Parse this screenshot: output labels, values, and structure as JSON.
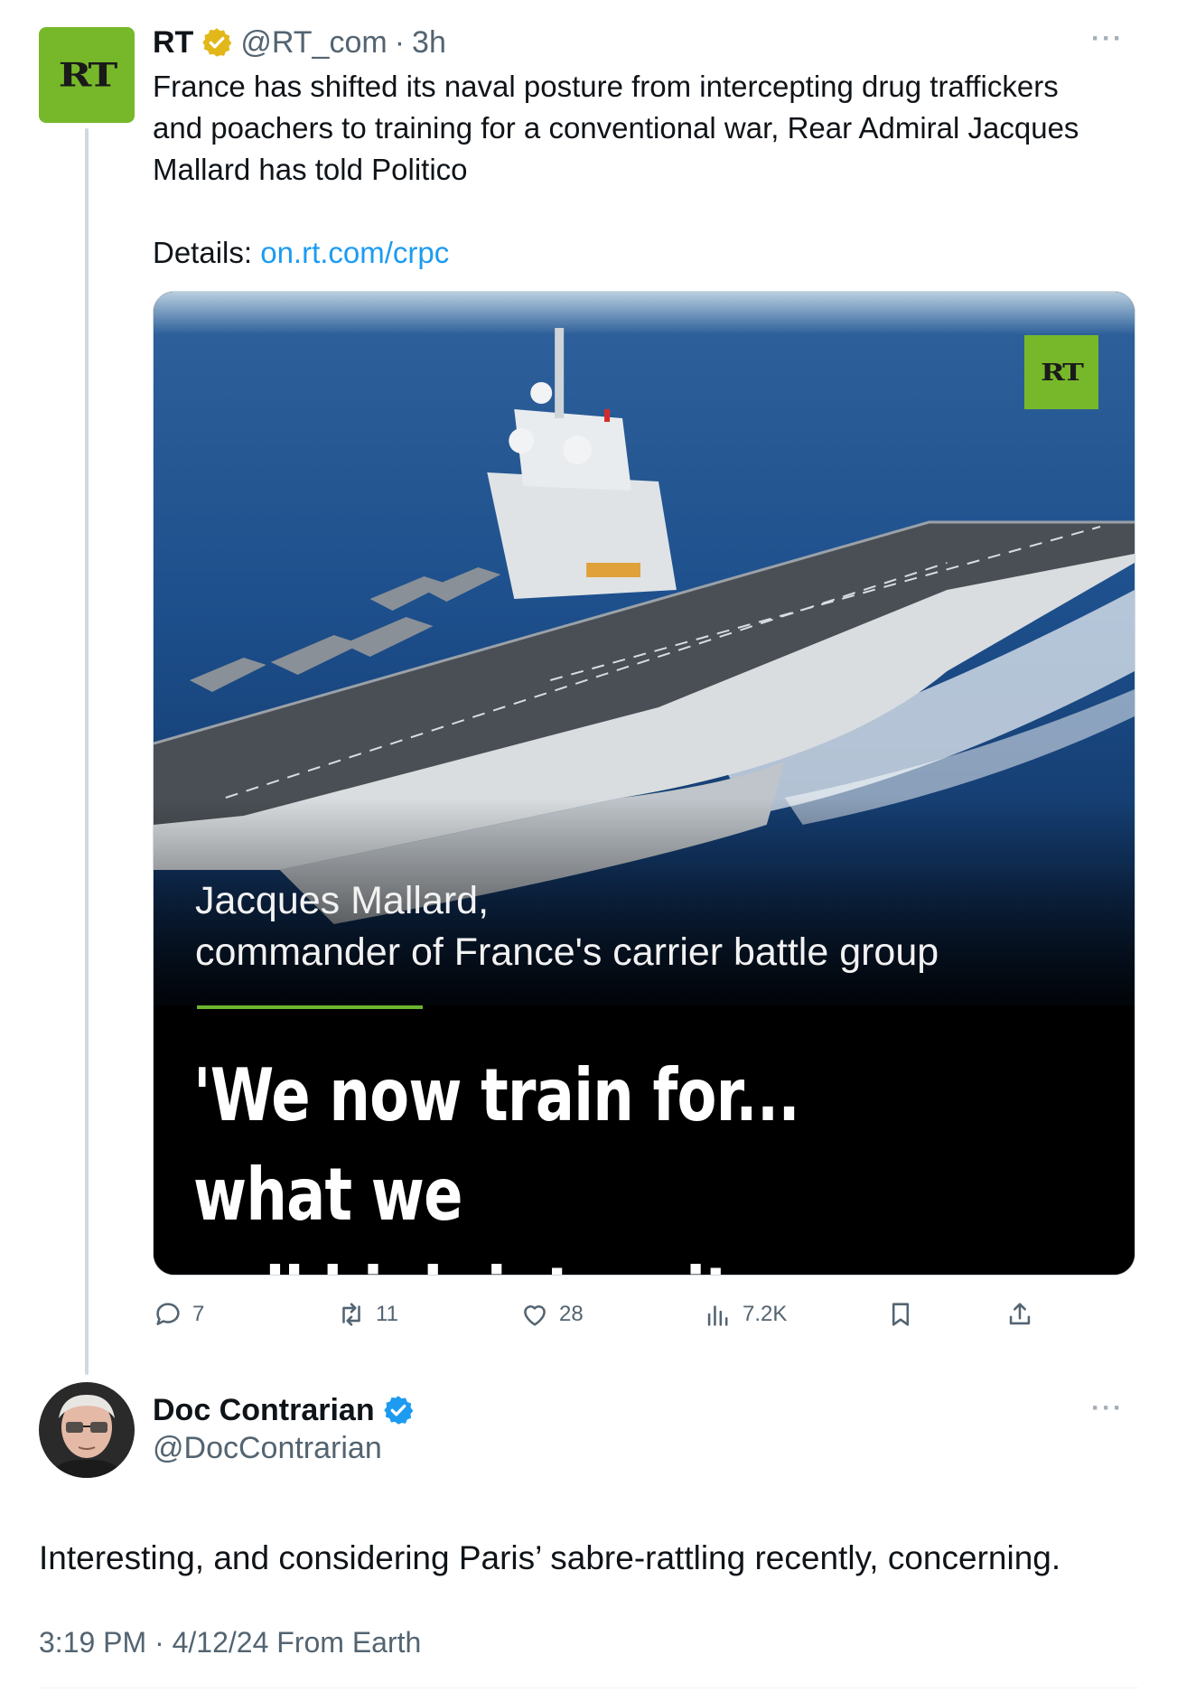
{
  "tweet": {
    "author_name": "RT",
    "handle": "@RT_com",
    "separator": "·",
    "time": "3h",
    "avatar_text": "RT",
    "text_lines": [
      "France has shifted its naval posture from intercepting drug traffickers",
      "and poachers to training for a conventional war, Rear Admiral Jacques",
      "Mallard has told Politico"
    ],
    "details_label": "Details:",
    "details_link": "on.rt.com/crpc",
    "more_label": "···",
    "media": {
      "watermark": "RT",
      "name_line": "Jacques Mallard,",
      "role_line": "commander of France's carrier battle group",
      "quote_line1": "'We now train for... what we",
      "quote_line2": "call high-intensity warfare'"
    },
    "actions": {
      "replies": "7",
      "retweets": "11",
      "likes": "28",
      "views": "7.2K"
    }
  },
  "reply": {
    "author_name": "Doc Contrarian",
    "handle": "@DocContrarian",
    "more_label": "···",
    "text": "Interesting, and considering Paris’ sabre-rattling recently, concerning.",
    "timestamp": "3:19 PM · 4/12/24 From Earth"
  },
  "colors": {
    "rt_green": "#77b82a",
    "link_blue": "#1d9bf0",
    "verified_gold": "#e2b719",
    "verified_blue": "#1d9bf0",
    "muted_text": "#536471"
  }
}
